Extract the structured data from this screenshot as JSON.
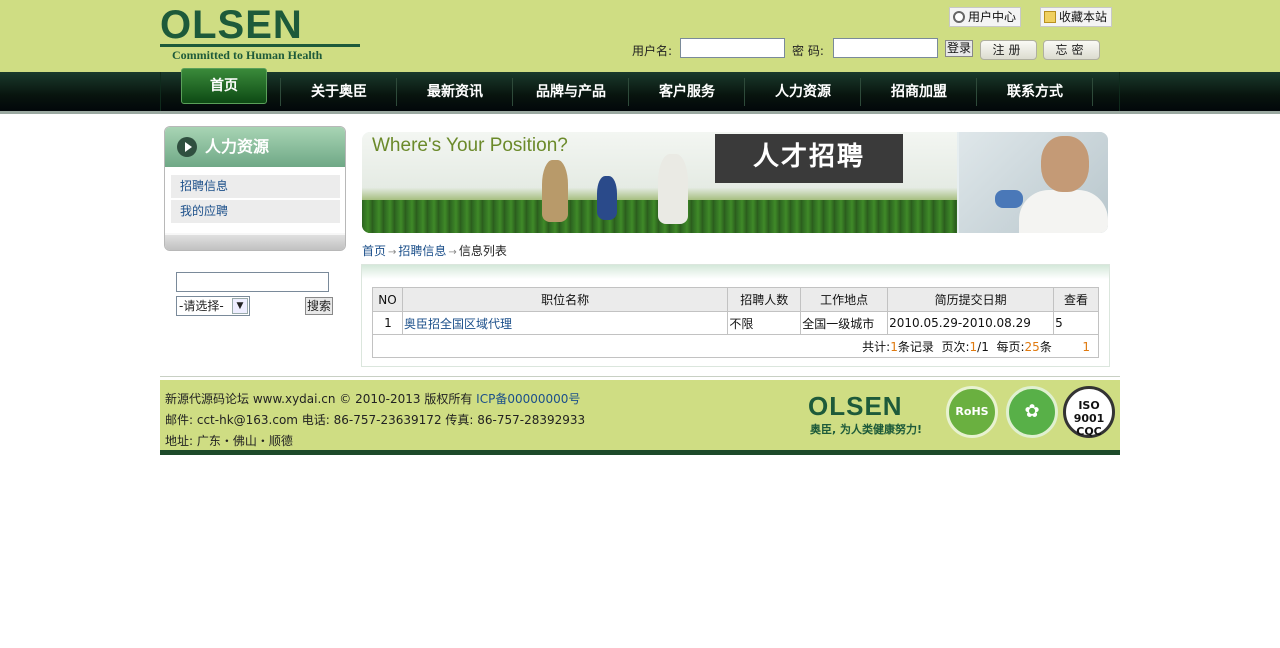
{
  "header": {
    "logo_word": "OLSEN",
    "logo_tagline": "Committed to Human Health",
    "user_center": "用户中心",
    "favorite": "收藏本站",
    "username_label": "用户名:",
    "password_label": "密 码:",
    "login_button": "登录",
    "register_button": "注册",
    "forgot_button": "忘密"
  },
  "nav": {
    "items": [
      "首页",
      "关于奥臣",
      "最新资讯",
      "品牌与产品",
      "客户服务",
      "人力资源",
      "招商加盟",
      "联系方式"
    ]
  },
  "sidebar": {
    "title": "人力资源",
    "items": [
      "招聘信息",
      "我的应聘"
    ],
    "search_select_value": "-请选择-",
    "search_button": "搜索"
  },
  "banner": {
    "title": "Where's Your Position?",
    "tag": "人才招聘"
  },
  "breadcrumb": [
    "首页",
    "招聘信息",
    "信息列表"
  ],
  "table": {
    "headers": [
      "NO",
      "职位名称",
      "招聘人数",
      "工作地点",
      "简历提交日期",
      "查看"
    ],
    "rows": [
      [
        "1",
        "奥臣招全国区域代理",
        "不限",
        "全国一级城市",
        "2010.05.29-2010.08.29",
        "5"
      ]
    ],
    "pager": {
      "total_label": "共计:",
      "total": "1",
      "total_suffix": "条记录",
      "page_label": "页次:",
      "page_current": "1",
      "page_total": "/1",
      "per_page_label": "每页:",
      "per_page": "25",
      "per_page_suffix": "条",
      "page_link": "1"
    }
  },
  "footer": {
    "line1_text": "新源代源码论坛 www.xydai.cn © 2010-2013 版权所有 ",
    "line1_icp": "ICP备00000000号",
    "line2": "邮件: cct-hk@163.com 电话: 86-757-23639172  传真: 86-757-28392933",
    "line3": "地址: 广东・佛山・顺德",
    "logo_word": "OLSEN",
    "logo_tagline": "奥臣, 为人类健康努力!",
    "cert_rohs": "RoHS",
    "cert_iso_line1": "ISO",
    "cert_iso_line2": "9001",
    "cert_iso_line3": "CQC"
  },
  "colors": {
    "header_bg": "#cfdd83",
    "brand_green": "#1d5a3a",
    "nav_bg": "#0a1a12",
    "link_blue": "#1b4f8a",
    "pager_accent": "#e07a10"
  }
}
